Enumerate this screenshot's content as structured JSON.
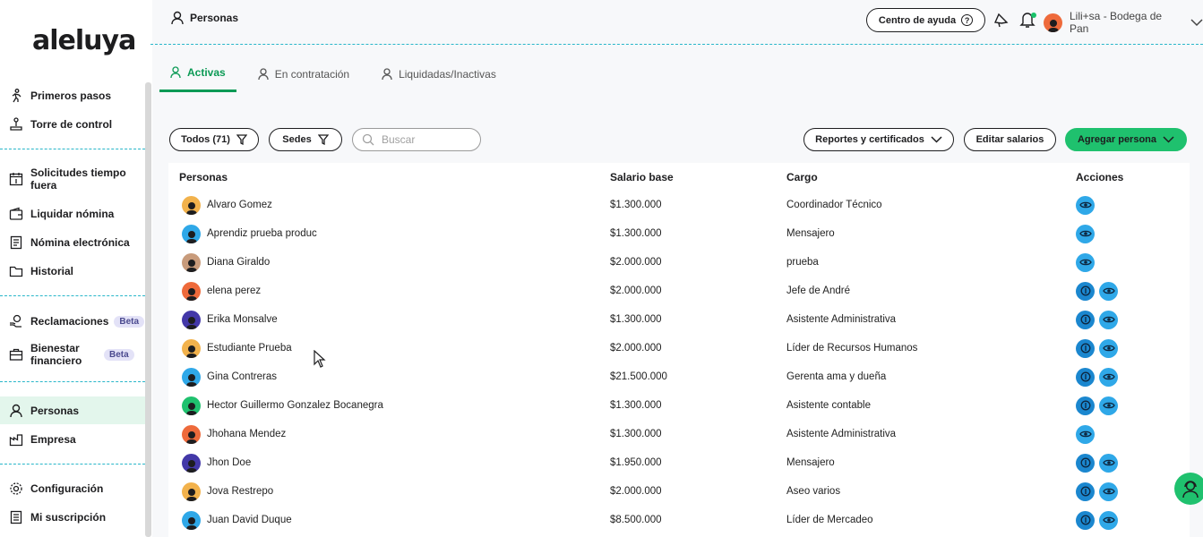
{
  "app": {
    "logo_text": "aleluya"
  },
  "sidebar": {
    "items": [
      {
        "label": "Primeros pasos",
        "icon": "running-person-icon"
      },
      {
        "label": "Torre de control",
        "icon": "joystick-icon"
      },
      {
        "label": "Solicitudes tiempo fuera",
        "icon": "calendar-icon"
      },
      {
        "label": "Liquidar nómina",
        "icon": "wallet-icon"
      },
      {
        "label": "Nómina electrónica",
        "icon": "document-icon"
      },
      {
        "label": "Historial",
        "icon": "folder-icon"
      },
      {
        "label": "Reclamaciones",
        "badge": "Beta",
        "icon": "coin-hand-icon"
      },
      {
        "label": "Bienestar financiero",
        "badge": "Beta",
        "icon": "briefcase-icon"
      },
      {
        "label": "Personas",
        "icon": "person-icon",
        "active": true
      },
      {
        "label": "Empresa",
        "icon": "factory-icon"
      },
      {
        "label": "Configuración",
        "icon": "gear-icon"
      },
      {
        "label": "Mi suscripción",
        "icon": "receipt-icon"
      }
    ]
  },
  "header": {
    "title": "Personas",
    "help_label": "Centro de ayuda",
    "user_label": "Lili+sa - Bodega de Pan"
  },
  "tabs": [
    {
      "label": "Activas",
      "active": true
    },
    {
      "label": "En contratación"
    },
    {
      "label": "Liquidadas/Inactivas"
    }
  ],
  "toolbar": {
    "filter_all": "Todos (71)",
    "filter_sedes": "Sedes",
    "search_placeholder": "Buscar",
    "reports": "Reportes y certificados",
    "edit_salaries": "Editar salarios",
    "add_person": "Agregar persona"
  },
  "table": {
    "headers": {
      "person": "Personas",
      "salary": "Salario base",
      "role": "Cargo",
      "actions": "Acciones"
    },
    "rows": [
      {
        "name": "Alvaro Gomez",
        "salary": "$1.300.000",
        "role": "Coordinador Técnico",
        "avatar_color": "#f2b24c",
        "actions": 1
      },
      {
        "name": "Aprendiz prueba produc",
        "salary": "$1.300.000",
        "role": "Mensajero",
        "avatar_color": "#2fa8e8",
        "actions": 1
      },
      {
        "name": "Diana Giraldo",
        "salary": "$2.000.000",
        "role": "prueba",
        "avatar_color": "#c89b7b",
        "actions": 1
      },
      {
        "name": "elena perez",
        "salary": "$2.000.000",
        "role": "Jefe de André",
        "avatar_color": "#ee6a3b",
        "actions": 2
      },
      {
        "name": "Erika Monsalve",
        "salary": "$1.300.000",
        "role": "Asistente Administrativa",
        "avatar_color": "#4338a8",
        "actions": 2
      },
      {
        "name": "Estudiante Prueba",
        "salary": "$2.000.000",
        "role": "Líder de Recursos Humanos",
        "avatar_color": "#f2b24c",
        "actions": 2
      },
      {
        "name": "Gina Contreras",
        "salary": "$21.500.000",
        "role": "Gerenta ama y dueña",
        "avatar_color": "#2fa8e8",
        "actions": 2
      },
      {
        "name": "Hector Guillermo Gonzalez Bocanegra",
        "salary": "$1.300.000",
        "role": "Asistente contable",
        "avatar_color": "#1fc16e",
        "actions": 2
      },
      {
        "name": "Jhohana Mendez",
        "salary": "$1.300.000",
        "role": "Asistente Administrativa",
        "avatar_color": "#ee6a3b",
        "actions": 1
      },
      {
        "name": "Jhon Doe",
        "salary": "$1.950.000",
        "role": "Mensajero",
        "avatar_color": "#4338a8",
        "actions": 2
      },
      {
        "name": "Jova Restrepo",
        "salary": "$2.000.000",
        "role": "Aseo varios",
        "avatar_color": "#f2b24c",
        "actions": 2
      },
      {
        "name": "Juan David Duque",
        "salary": "$8.500.000",
        "role": "Líder de Mercadeo",
        "avatar_color": "#2fa8e8",
        "actions": 2
      }
    ]
  },
  "colors": {
    "accent_green": "#1fc16e",
    "divider_teal": "#28b6c9",
    "action_blue": "#2fa8e8"
  }
}
